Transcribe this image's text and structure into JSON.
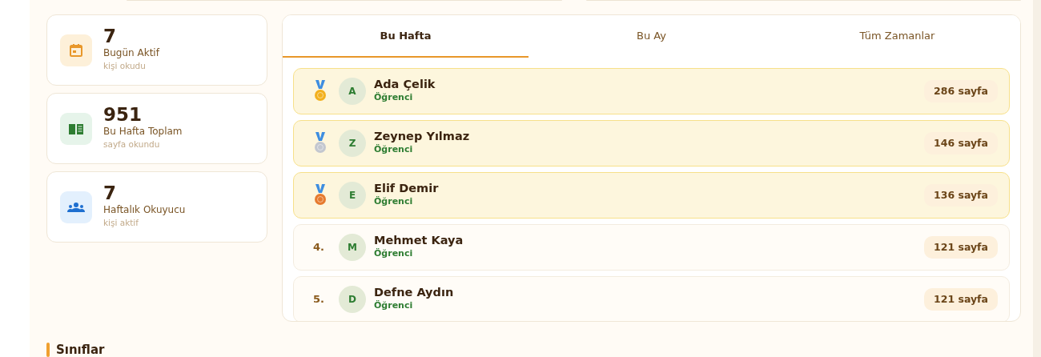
{
  "stats": [
    {
      "kind": "calendar",
      "color": "#e8972a",
      "value": "7",
      "label": "Bugün Aktif",
      "sub": "kişi okudu"
    },
    {
      "kind": "book",
      "color": "#2e7d32",
      "value": "951",
      "label": "Bu Hafta Toplam",
      "sub": "sayfa okundu"
    },
    {
      "kind": "people",
      "color": "#1e6fd0",
      "value": "7",
      "label": "Haftalık Okuyucu",
      "sub": "kişi aktif"
    }
  ],
  "leaderboard": {
    "tabs": [
      {
        "label": "Bu Hafta",
        "selected": true
      },
      {
        "label": "Bu Ay",
        "selected": false
      },
      {
        "label": "Tüm Zamanlar",
        "selected": false
      }
    ],
    "rows": [
      {
        "kind": "medal",
        "color": "#f2b01e",
        "highlighted": true,
        "initial": "A",
        "name": "Ada Çelik",
        "role": "Öğrenci",
        "pages": "286 sayfa"
      },
      {
        "kind": "medal",
        "color": "#c3c7cf",
        "highlighted": true,
        "initial": "Z",
        "name": "Zeynep Yılmaz",
        "role": "Öğrenci",
        "pages": "146 sayfa"
      },
      {
        "kind": "medal",
        "color": "#e67a2e",
        "highlighted": true,
        "initial": "E",
        "name": "Elif Demir",
        "role": "Öğrenci",
        "pages": "136 sayfa"
      },
      {
        "kind": "number",
        "rank": "4.",
        "highlighted": false,
        "initial": "M",
        "name": "Mehmet Kaya",
        "role": "Öğrenci",
        "pages": "121 sayfa"
      },
      {
        "kind": "number",
        "rank": "5.",
        "highlighted": false,
        "initial": "D",
        "name": "Defne Aydın",
        "role": "Öğrenci",
        "pages": "121 sayfa"
      }
    ]
  },
  "section_title": "Sınıflar"
}
